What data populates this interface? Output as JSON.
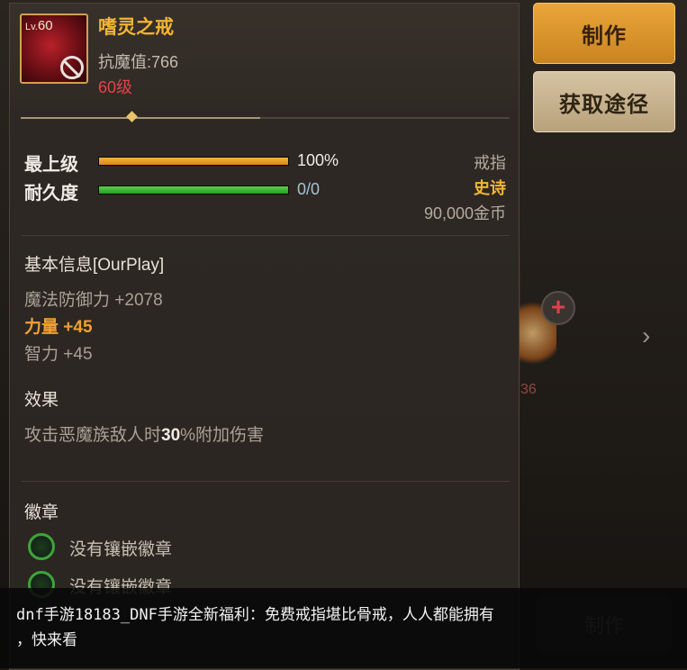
{
  "right_buttons": {
    "make_label": "制作",
    "source_label": "获取途径"
  },
  "background": {
    "item_count": "36",
    "bottom_button_label": "制作"
  },
  "item": {
    "level_prefix": "Lv.",
    "level": "60",
    "name": "嗜灵之戒",
    "stat_line": "抗魔值:766",
    "level_requirement": "60级"
  },
  "bars": {
    "upgrade_label": "最上级",
    "upgrade_value_text": "100%",
    "upgrade_fill": 1.0,
    "durability_label": "耐久度",
    "durability_value_text": "0/0",
    "durability_fill": 1.0
  },
  "meta": {
    "type": "戒指",
    "rarity": "史诗",
    "price": "90,000金币"
  },
  "basic_info": {
    "title": "基本信息[OurPlay]",
    "stats": [
      "魔法防御力 +2078",
      "力量 +45",
      "智力 +45"
    ]
  },
  "effect": {
    "title": "效果",
    "text_before": "攻击恶魔族敌人时",
    "text_highlight": "30",
    "text_after": "%附加伤害"
  },
  "emblems": {
    "title": "徽章",
    "slots": [
      "没有镶嵌徽章",
      "没有镶嵌徽章"
    ]
  },
  "caption": {
    "line1": "dnf手游18183_DNF手游全新福利：免费戒指堪比骨戒，人人都能拥有",
    "line2": "，快来看"
  },
  "colors": {
    "epic": "#f3b533",
    "level_requirement": "#e8414b",
    "make_button": "#e0a03a",
    "source_button": "#cdb894",
    "upgrade_bar": "#f0a82e",
    "durability_bar": "#3fbf38"
  }
}
